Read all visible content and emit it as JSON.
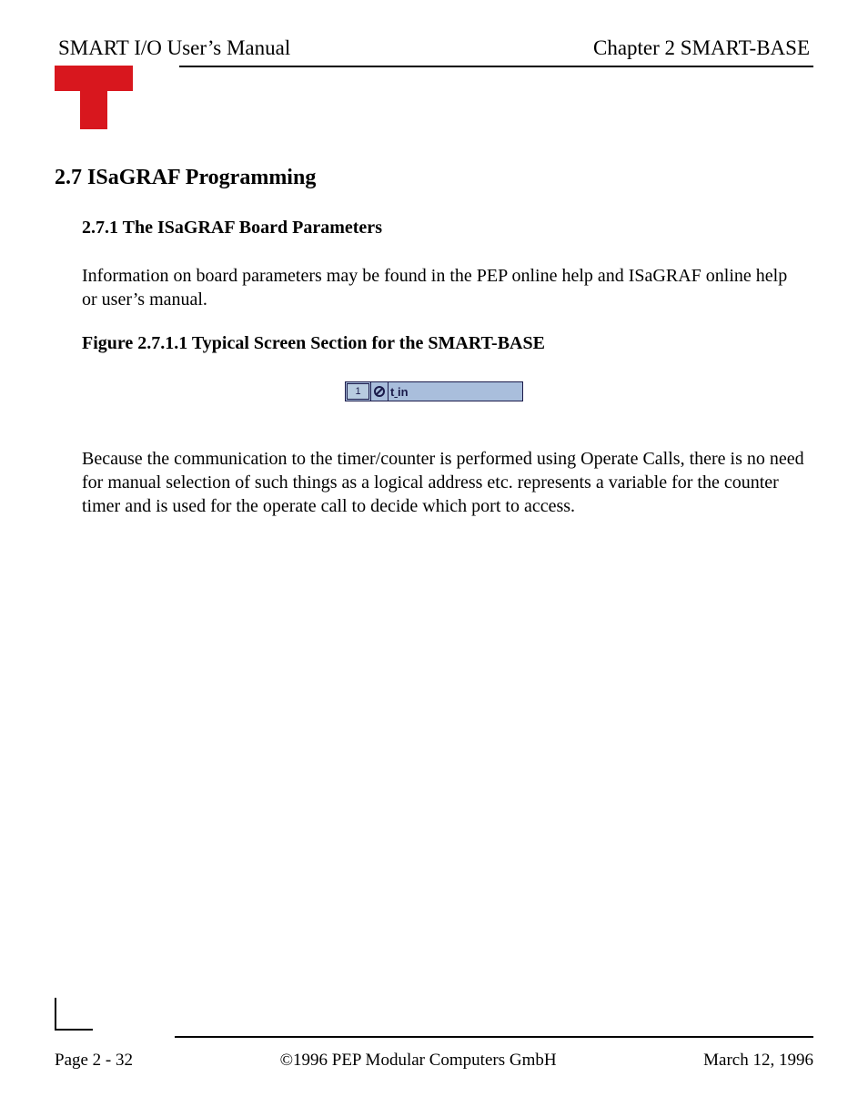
{
  "header": {
    "left": "SMART I/O User’s Manual",
    "right": "Chapter 2  SMART-BASE"
  },
  "section": {
    "heading": "2.7 ISaGRAF Programming",
    "sub_heading": "2.7.1 The ISaGRAF Board Parameters",
    "para1": "Information on board parameters may be found in the PEP online help and ISaGRAF online help or user’s manual.",
    "figure_caption": "Figure 2.7.1.1 Typical Screen Section for the SMART-BASE",
    "io_box": {
      "index": "1",
      "label_prefix": "t",
      "label_suffix": "in"
    },
    "para2": "Because the communication to the timer/counter is performed using Operate Calls, there is no need for manual selection of such things as a logical address etc.          represents a variable for the counter timer and is used for the operate call to decide which port to access."
  },
  "footer": {
    "page": "Page 2 - 32",
    "copyright": "©1996 PEP Modular Computers GmbH",
    "date": "March 12, 1996"
  }
}
